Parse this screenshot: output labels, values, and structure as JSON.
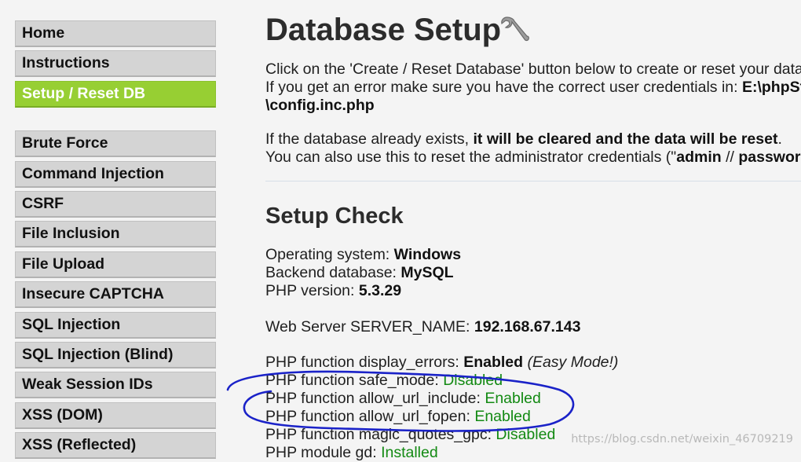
{
  "sidebar": {
    "group1": [
      {
        "label": "Home",
        "active": false
      },
      {
        "label": "Instructions",
        "active": false
      },
      {
        "label": "Setup / Reset DB",
        "active": true
      }
    ],
    "group2": [
      {
        "label": "Brute Force"
      },
      {
        "label": "Command Injection"
      },
      {
        "label": "CSRF"
      },
      {
        "label": "File Inclusion"
      },
      {
        "label": "File Upload"
      },
      {
        "label": "Insecure CAPTCHA"
      },
      {
        "label": "SQL Injection"
      },
      {
        "label": "SQL Injection (Blind)"
      },
      {
        "label": "Weak Session IDs"
      },
      {
        "label": "XSS (DOM)"
      },
      {
        "label": "XSS (Reflected)"
      }
    ],
    "active_color": "#97cf33"
  },
  "main": {
    "title": "Database Setup",
    "title_icon": "wrench-icon",
    "intro": {
      "line1": "Click on the 'Create / Reset Database' button below to create or reset your data",
      "line2_prefix": "If you get an error make sure you have the correct user credentials in: ",
      "line2_path": "E:\\phpSt",
      "line3_path": "\\config.inc.php"
    },
    "reset_note": {
      "line1_prefix": "If the database already exists, ",
      "line1_bold": "it will be cleared and the data will be reset",
      "line1_suffix": ".",
      "line2_prefix": "You can also use this to reset the administrator credentials (\"",
      "line2_user": "admin",
      "line2_sep": " // ",
      "line2_pass": "passwor"
    },
    "setup_check": {
      "heading": "Setup Check",
      "os_label": "Operating system: ",
      "os_value": "Windows",
      "db_label": "Backend database: ",
      "db_value": "MySQL",
      "php_label": "PHP version: ",
      "php_value": "5.3.29",
      "server_label": "Web Server SERVER_NAME: ",
      "server_value": "192.168.67.143",
      "display_errors_label": "PHP function display_errors: ",
      "display_errors_value": "Enabled",
      "display_errors_note": " (Easy Mode!)",
      "safe_mode_label": "PHP function safe_mode: ",
      "safe_mode_value": "Disabled",
      "allow_url_include_label": "PHP function allow_url_include: ",
      "allow_url_include_value": "Enabled",
      "allow_url_fopen_label": "PHP function allow_url_fopen: ",
      "allow_url_fopen_value": "Enabled",
      "magic_quotes_label": "PHP function magic_quotes_gpc: ",
      "magic_quotes_value": "Disabled",
      "gd_label": "PHP module gd: ",
      "gd_value": "Installed"
    },
    "status_color": "#138a13"
  },
  "watermark": "https://blog.csdn.net/weixin_46709219",
  "annotation_color": "#1a22c8"
}
